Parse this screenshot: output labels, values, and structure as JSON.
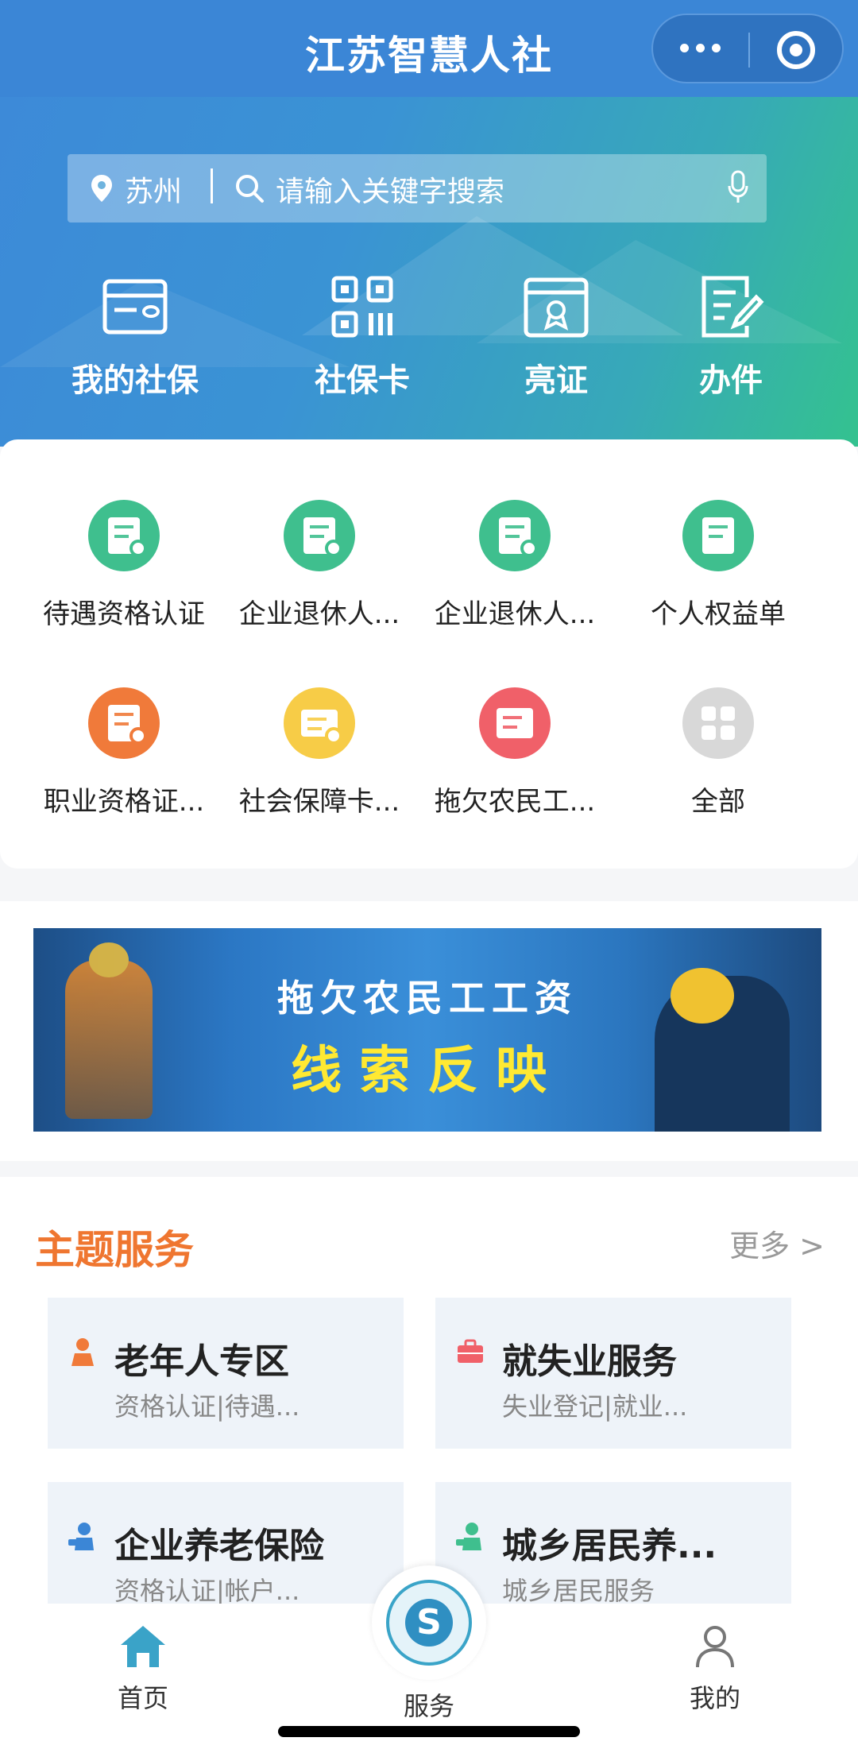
{
  "header": {
    "title": "江苏智慧人社"
  },
  "search": {
    "city": "苏州",
    "placeholder": "请输入关键字搜索"
  },
  "quick_actions": [
    {
      "label": "我的社保",
      "icon": "social-security-card-icon"
    },
    {
      "label": "社保卡",
      "icon": "qr-code-icon"
    },
    {
      "label": "亮证",
      "icon": "certificate-icon"
    },
    {
      "label": "办件",
      "icon": "edit-document-icon"
    }
  ],
  "services": [
    {
      "label": "待遇资格认证",
      "color": "#3fbf8e"
    },
    {
      "label": "企业退休人...",
      "color": "#3fbf8e"
    },
    {
      "label": "企业退休人...",
      "color": "#3fbf8e"
    },
    {
      "label": "个人权益单",
      "color": "#3fbf8e"
    },
    {
      "label": "职业资格证...",
      "color": "#f07a3a"
    },
    {
      "label": "社会保障卡...",
      "color": "#f7cc47"
    },
    {
      "label": "拖欠农民工...",
      "color": "#f06069"
    },
    {
      "label": "全部",
      "color": "#d8d8d8"
    }
  ],
  "banner": {
    "line1": "拖欠农民工工资",
    "line2": "线索反映"
  },
  "theme": {
    "title": "主题服务",
    "more": "更多 >",
    "cards": [
      {
        "name": "老年人专区",
        "sub": "资格认证|待遇...",
        "icon": "elderly-icon",
        "color": "#f07a3a"
      },
      {
        "name": "就失业服务",
        "sub": "失业登记|就业...",
        "icon": "briefcase-icon",
        "color": "#f06069"
      },
      {
        "name": "企业养老保险",
        "sub": "资格认证|帐户...",
        "icon": "enterprise-pension-icon",
        "color": "#3b86d6"
      },
      {
        "name": "城乡居民养...",
        "sub": "城乡居民服务",
        "icon": "resident-pension-icon",
        "color": "#3fbf8e"
      }
    ]
  },
  "tabbar": {
    "items": [
      {
        "label": "首页",
        "icon": "home-icon",
        "active": true
      },
      {
        "label": "服务",
        "icon": "service-logo-icon",
        "active": false
      },
      {
        "label": "我的",
        "icon": "profile-icon",
        "active": false
      }
    ]
  },
  "colors": {
    "primary": "#3b86d6",
    "accent": "#ef7630",
    "green": "#3fbf8e"
  }
}
